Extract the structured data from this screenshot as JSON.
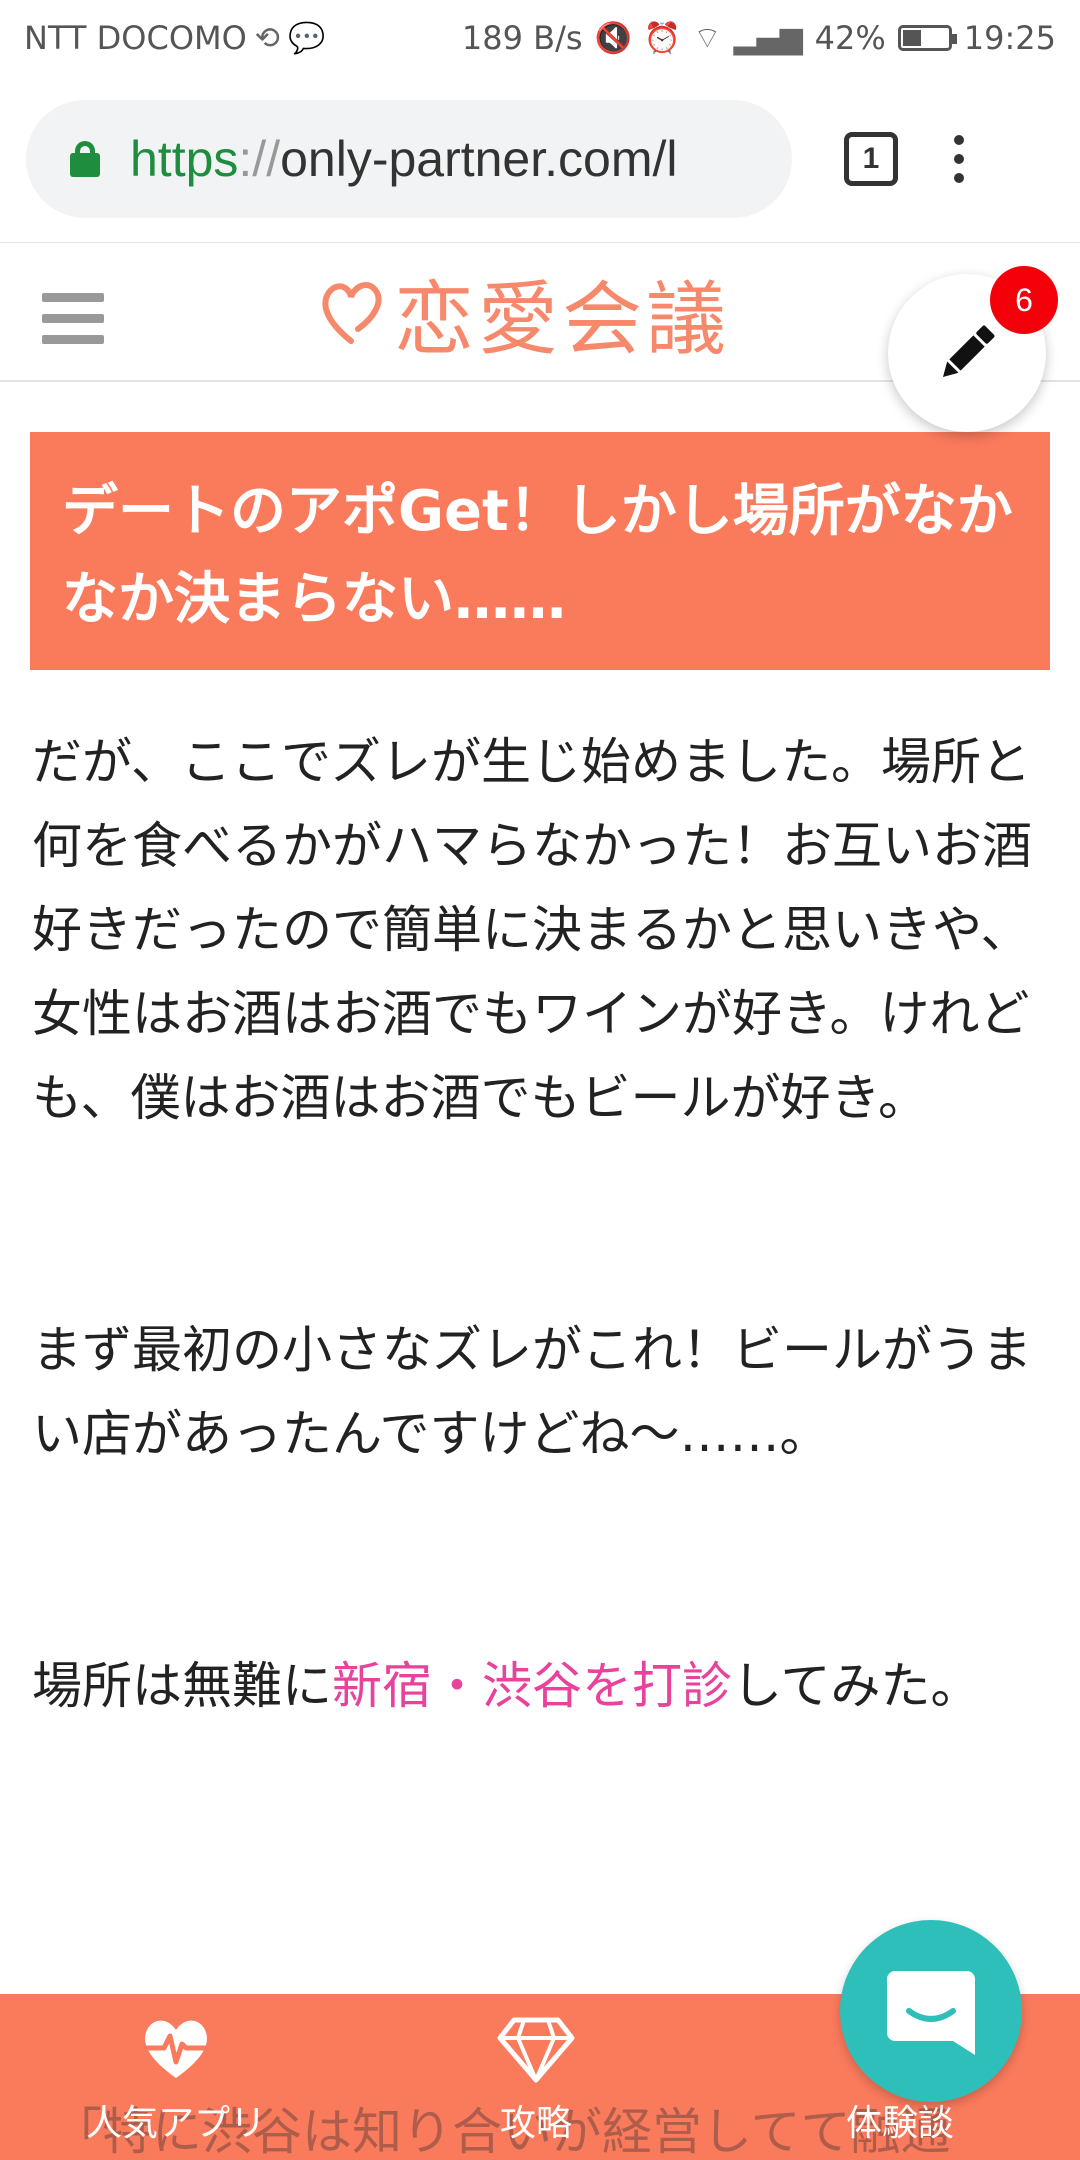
{
  "status_bar": {
    "carrier": "NTT DOCOMO",
    "net_speed": "189 B/s",
    "battery": "42%",
    "battery_level": 0.42,
    "time": "19:25"
  },
  "browser": {
    "url_scheme": "https",
    "url_sep": "://",
    "url_host": "only-partner.com/l",
    "tab_count": "1"
  },
  "site": {
    "logo_text": "恋愛会議",
    "notification_count": "6"
  },
  "article": {
    "heading": "デートのアポGet！しかし場所がなかなか決まらない……",
    "paragraph1": "だが、ここでズレが生じ始めました。場所と何を食べるかがハマらなかった！お互いお酒好きだったので簡単に決まるかと思いきや、女性はお酒はお酒でもワインが好き。けれども、僕はお酒はお酒でもビールが好き。",
    "paragraph2": "まず最初の小さなズレがこれ！ビールがうまい店があったんですけどね〜……。",
    "paragraph3_before": "場所は無難に",
    "paragraph3_link": "新宿・渋谷を打診",
    "paragraph3_after": "してみた。",
    "peek_text": "「特に渋谷は知り合いが経営してて融通"
  },
  "bottom_nav": {
    "items": [
      {
        "label": "人気アプリ",
        "icon": "heartbeat-icon"
      },
      {
        "label": "攻略",
        "icon": "diamond-icon"
      },
      {
        "label": "体験談",
        "icon": "chat-icon"
      }
    ]
  },
  "colors": {
    "accent": "#fa7a5c",
    "logo": "#f6896b",
    "link": "#e8429c",
    "badge": "#f4000a",
    "chat": "#2fbfbb",
    "secure": "#1e8e3e"
  }
}
